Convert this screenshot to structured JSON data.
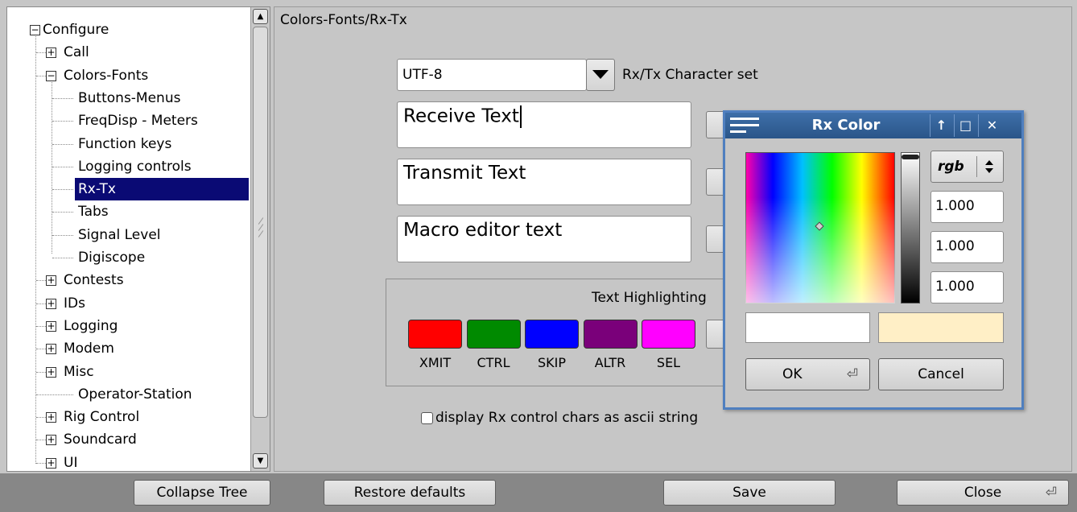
{
  "tree": {
    "items": [
      {
        "label": "Configure",
        "toggle": "−"
      },
      {
        "label": "Call",
        "toggle": "+"
      },
      {
        "label": "Colors-Fonts",
        "toggle": "−"
      },
      {
        "label": "Buttons-Menus"
      },
      {
        "label": "FreqDisp - Meters"
      },
      {
        "label": "Function keys"
      },
      {
        "label": "Logging controls"
      },
      {
        "label": "Rx-Tx",
        "selected": true
      },
      {
        "label": "Tabs"
      },
      {
        "label": "Signal Level"
      },
      {
        "label": "Digiscope"
      },
      {
        "label": "Contests",
        "toggle": "+"
      },
      {
        "label": "IDs",
        "toggle": "+"
      },
      {
        "label": "Logging",
        "toggle": "+"
      },
      {
        "label": "Modem",
        "toggle": "+"
      },
      {
        "label": "Misc",
        "toggle": "+"
      },
      {
        "label": "Operator-Station"
      },
      {
        "label": "Rig Control",
        "toggle": "+"
      },
      {
        "label": "Soundcard",
        "toggle": "+"
      },
      {
        "label": "UI",
        "toggle": "+"
      }
    ],
    "scroll_up": "▲",
    "scroll_down": "▼"
  },
  "panel": {
    "title": "Colors-Fonts/Rx-Tx",
    "charset_value": "UTF-8",
    "charset_label": "Rx/Tx Character set",
    "receive_text": "Receive Text",
    "transmit_text": "Transmit Text",
    "macro_text": "Macro editor text",
    "highlight_title": "Text Highlighting",
    "swatches": [
      {
        "label": "XMIT",
        "color": "#ff0000"
      },
      {
        "label": "CTRL",
        "color": "#008a00"
      },
      {
        "label": "SKIP",
        "color": "#0000ff"
      },
      {
        "label": "ALTR",
        "color": "#7a007a"
      },
      {
        "label": "SEL",
        "color": "#ff00ff"
      }
    ],
    "checkbox_label": "display Rx control chars as ascii string"
  },
  "bottom": {
    "collapse": "Collapse Tree",
    "restore": "Restore defaults",
    "save": "Save",
    "close": "Close",
    "enter_glyph": "⏎"
  },
  "dialog": {
    "title": "Rx Color",
    "mode": "rgb",
    "r": "1.000",
    "g": "1.000",
    "b": "1.000",
    "old_color": "#ffffff",
    "new_color": "#ffefc6",
    "ok": "OK",
    "cancel": "Cancel",
    "enter_glyph": "⏎",
    "tb_up": "↑",
    "tb_max": "□",
    "tb_close": "✕"
  }
}
